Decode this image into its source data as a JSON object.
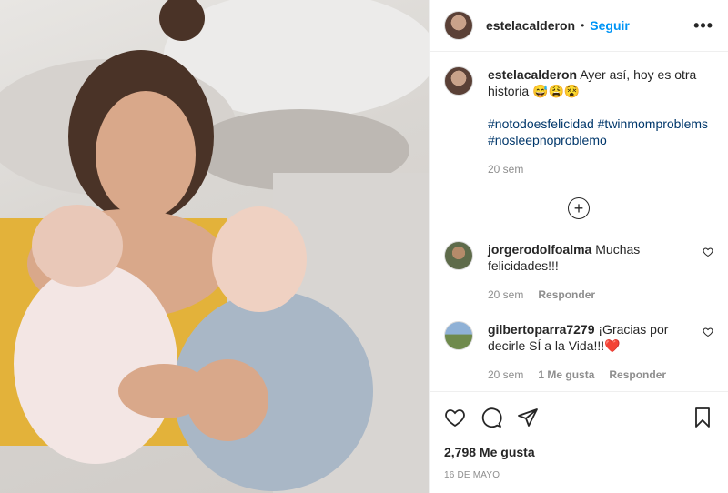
{
  "post": {
    "username": "estelacalderon",
    "follow_label": "Seguir",
    "more_label": "•••",
    "caption_text": "Ayer así, hoy es otra historia 😅😩😵",
    "hashtags": "#notodoesfelicidad #twinmomproblems #nosleepnoproblemo",
    "caption_time": "20 sem",
    "likes": "2,798 Me gusta",
    "date": "16 DE MAYO"
  },
  "comments": [
    {
      "username": "jorgerodolfoalma",
      "text": "Muchas felicidades!!!",
      "time": "20 sem",
      "reply_label": "Responder"
    },
    {
      "username": "gilbertoparra7279",
      "text": "¡Gracias por decirle SÍ a la Vida!!!",
      "emoji": "❤️",
      "time": "20 sem",
      "likes_label": "1 Me gusta",
      "reply_label": "Responder"
    }
  ],
  "colors": {
    "follow_blue": "#0095f6",
    "hashtag_blue": "#00376b",
    "muted": "#8e8e8e"
  },
  "icons": [
    "heart-icon",
    "comment-icon",
    "share-icon",
    "bookmark-icon",
    "plus-circle-icon"
  ]
}
